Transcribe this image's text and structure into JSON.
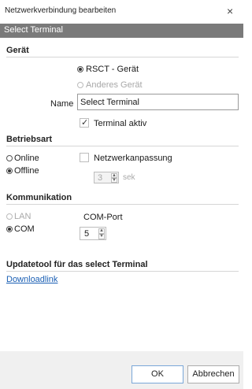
{
  "window": {
    "title": "Netzwerkverbindung bearbeiten",
    "close_glyph": "×",
    "header": "Select Terminal"
  },
  "geraet": {
    "section": "Gerät",
    "option_rsct": "RSCT - Gerät",
    "option_andere": "Anderes Gerät",
    "name_label": "Name",
    "name_value": "Select Terminal",
    "terminal_aktiv": "Terminal aktiv"
  },
  "betriebsart": {
    "section": "Betriebsart",
    "online": "Online",
    "offline": "Offline",
    "netzwerkanpassung": "Netzwerkanpassung",
    "sek_value": "3",
    "sek_unit": "sek"
  },
  "kommunikation": {
    "section": "Kommunikation",
    "lan": "LAN",
    "com": "COM",
    "com_port_label": "COM-Port",
    "com_port_value": "5"
  },
  "updatetool": {
    "section": "Updatetool für das select Terminal",
    "link": "Downloadlink"
  },
  "footer": {
    "ok": "OK",
    "cancel": "Abbrechen"
  }
}
